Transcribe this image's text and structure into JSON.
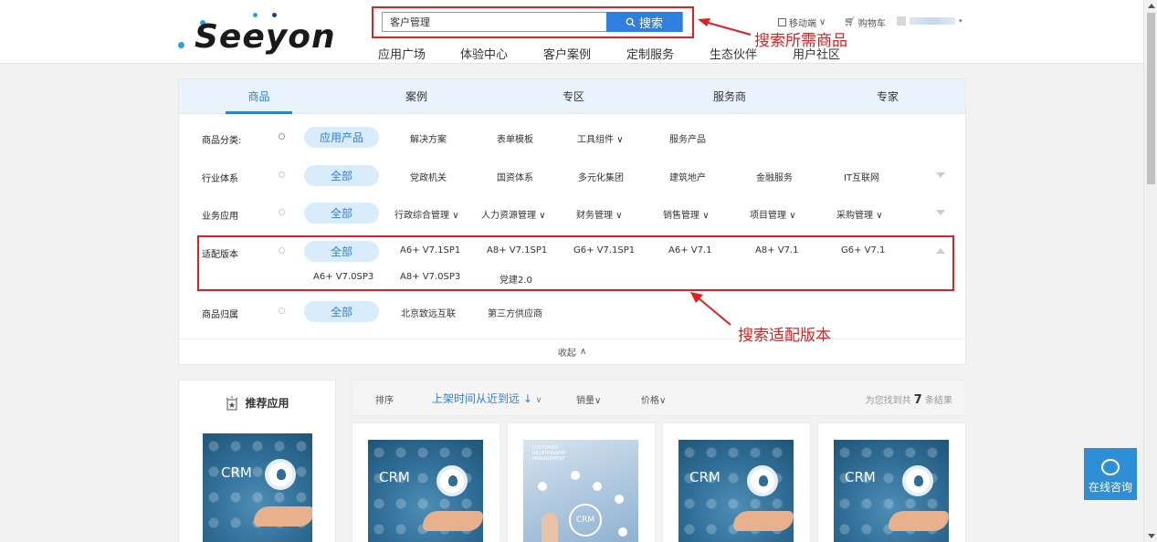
{
  "header": {
    "logo_text": "Seeyon",
    "search": {
      "value": "客户管理",
      "button_label": "搜索"
    },
    "nav": [
      "应用广场",
      "体验中心",
      "客户案例",
      "定制服务",
      "生态伙伴",
      "用户社区"
    ],
    "mobile_label": "移动端",
    "cart_label": "购物车",
    "annotation_search": "搜索所需商品"
  },
  "tabs": [
    "商品",
    "案例",
    "专区",
    "服务商",
    "专家"
  ],
  "filters": {
    "category": {
      "label": "商品分类:",
      "all": "应用产品",
      "options": [
        "解决方案",
        "表单模板",
        "工具组件",
        "服务产品"
      ]
    },
    "industry": {
      "label": "行业体系",
      "all": "全部",
      "options": [
        "党政机关",
        "国资体系",
        "多元化集团",
        "建筑地产",
        "金融服务",
        "IT互联网"
      ]
    },
    "business": {
      "label": "业务应用",
      "all": "全部",
      "options": [
        "行政综合管理",
        "人力资源管理",
        "财务管理",
        "销售管理",
        "项目管理",
        "采购管理"
      ]
    },
    "version": {
      "label": "适配版本",
      "all": "全部",
      "options_row1": [
        "A6+ V7.1SP1",
        "A8+ V7.1SP1",
        "G6+ V7.1SP1",
        "A6+ V7.1",
        "A8+ V7.1",
        "G6+ V7.1"
      ],
      "options_row2": [
        "A6+ V7.0SP3",
        "A8+ V7.0SP3",
        "党建2.0"
      ]
    },
    "owner": {
      "label": "商品归属",
      "all": "全部",
      "options": [
        "北京致远互联",
        "第三方供应商"
      ]
    },
    "collapse_label": "收起",
    "annotation_version": "搜索适配版本"
  },
  "recommend": {
    "title": "推荐应用",
    "thumb_label": "CRM"
  },
  "sortbar": {
    "label": "排序",
    "active": "上架时间从近到远",
    "sales": "销量",
    "price": "价格",
    "result_prefix": "为您找到共",
    "result_count": "7",
    "result_suffix": "条结果"
  },
  "cards": [
    {
      "label": "CRM"
    },
    {
      "label": "CRM",
      "subtitle": "CUSTOMER RELATIONSHIP MANAGEMENT"
    },
    {
      "label": "CRM"
    },
    {
      "label": "CRM"
    }
  ],
  "consult": {
    "label": "在线咨询"
  },
  "colors": {
    "accent": "#2e7fe0",
    "annotation": "#e02020",
    "chip_bg": "#d9ecfb",
    "consult_bg": "#2e8ed6"
  }
}
